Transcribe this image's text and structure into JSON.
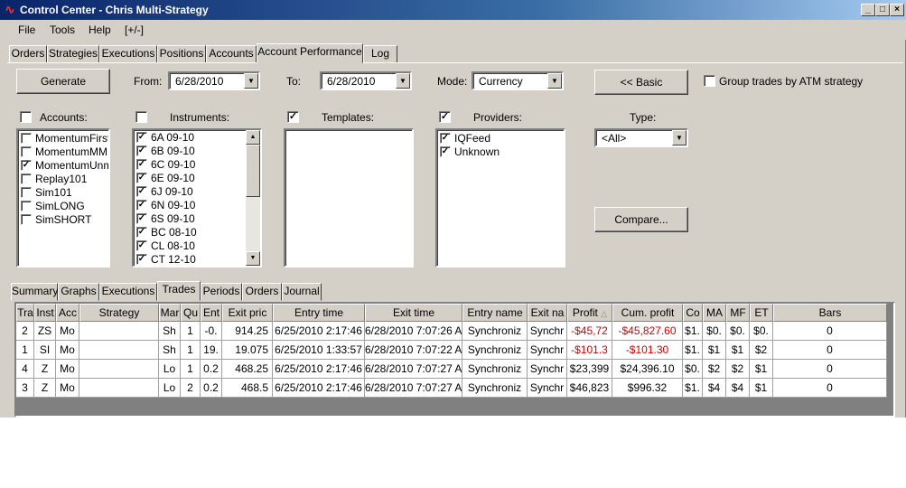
{
  "window": {
    "title": "Control Center - Chris Multi-Strategy",
    "min": "_",
    "max": "□",
    "close": "×"
  },
  "menu": [
    "File",
    "Tools",
    "Help",
    "[+/-]"
  ],
  "main_tabs": [
    "Orders",
    "Strategies",
    "Executions",
    "Positions",
    "Accounts",
    "Account Performance",
    "Log"
  ],
  "controls": {
    "generate": "Generate",
    "from_label": "From:",
    "from_value": "6/28/2010",
    "to_label": "To:",
    "to_value": "6/28/2010",
    "mode_label": "Mode:",
    "mode_value": "Currency",
    "basic": "<< Basic",
    "group_label": "Group trades by ATM strategy",
    "compare": "Compare...",
    "type_label": "Type:",
    "type_value": "<All>"
  },
  "accounts": {
    "label": "Accounts:",
    "checked": false,
    "items": [
      {
        "name": "MomentumFirst",
        "checked": false
      },
      {
        "name": "MomentumMM",
        "checked": false
      },
      {
        "name": "MomentumUnmar",
        "checked": true
      },
      {
        "name": "Replay101",
        "checked": false
      },
      {
        "name": "Sim101",
        "checked": false
      },
      {
        "name": "SimLONG",
        "checked": false
      },
      {
        "name": "SimSHORT",
        "checked": false
      }
    ]
  },
  "instruments": {
    "label": "Instruments:",
    "checked": false,
    "items": [
      {
        "name": "6A 09-10",
        "checked": true
      },
      {
        "name": "6B 09-10",
        "checked": true
      },
      {
        "name": "6C 09-10",
        "checked": true
      },
      {
        "name": "6E 09-10",
        "checked": true
      },
      {
        "name": "6J 09-10",
        "checked": true
      },
      {
        "name": "6N 09-10",
        "checked": true
      },
      {
        "name": "6S 09-10",
        "checked": true
      },
      {
        "name": "BC 08-10",
        "checked": true
      },
      {
        "name": "CL 08-10",
        "checked": true
      },
      {
        "name": "CT 12-10",
        "checked": true
      }
    ]
  },
  "templates": {
    "label": "Templates:",
    "checked": true,
    "items": []
  },
  "providers": {
    "label": "Providers:",
    "checked": true,
    "items": [
      {
        "name": "IQFeed",
        "checked": true
      },
      {
        "name": "Unknown",
        "checked": true
      }
    ]
  },
  "sub_tabs": [
    "Summary",
    "Graphs",
    "Executions",
    "Trades",
    "Periods",
    "Orders",
    "Journal"
  ],
  "table": {
    "columns": [
      "Tra",
      "Inst",
      "Acc",
      "Strategy",
      "Mar",
      "Qu",
      "Ent",
      "Exit pric",
      "Entry time",
      "Exit time",
      "Entry name",
      "Exit na",
      "Profit",
      "Cum. profit",
      "Co",
      "MA",
      "MF",
      "ET",
      "Bars"
    ],
    "sort_indicator": "△",
    "rows": [
      [
        "2",
        "ZS",
        "Mo",
        "",
        "Sh",
        "1",
        "-0.",
        "914.25",
        "6/25/2010 2:17:46",
        "6/28/2010 7:07:26 A",
        "Synchroniz",
        "Synchr",
        "-$45,72",
        "-$45,827.60",
        "$1.",
        "$0.",
        "$0.",
        "$0.",
        "0"
      ],
      [
        "1",
        "SI",
        "Mo",
        "",
        "Sh",
        "1",
        "19.",
        "19.075",
        "6/25/2010 1:33:57",
        "6/28/2010 7:07:22 A",
        "Synchroniz",
        "Synchr",
        "-$101.3",
        "-$101.30",
        "$1.",
        "$1",
        "$1",
        "$2",
        "0"
      ],
      [
        "4",
        "Z",
        "Mo",
        "",
        "Lo",
        "1",
        "0.2",
        "468.25",
        "6/25/2010 2:17:46",
        "6/28/2010 7:07:27 A",
        "Synchroniz",
        "Synchr",
        "$23,399",
        "$24,396.10",
        "$0.",
        "$2",
        "$2",
        "$1",
        "0"
      ],
      [
        "3",
        "Z",
        "Mo",
        "",
        "Lo",
        "2",
        "0.2",
        "468.5",
        "6/25/2010 2:17:46",
        "6/28/2010 7:07:27 A",
        "Synchroniz",
        "Synchr",
        "$46,823",
        "$996.32",
        "$1.",
        "$4",
        "$4",
        "$1",
        "0"
      ]
    ]
  },
  "colors": {
    "negative": "#d00000",
    "title_start": "#0a246a",
    "title_end": "#a6caf0"
  }
}
